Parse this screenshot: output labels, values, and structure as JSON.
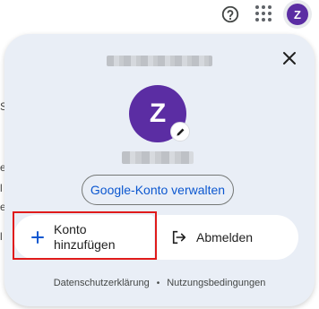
{
  "topbar": {
    "help_icon": "help-circle-icon",
    "apps_icon": "apps-grid-icon",
    "avatar_letter": "Z"
  },
  "page_left_edge": [
    "S",
    "e",
    "l",
    "e",
    "l"
  ],
  "account_panel": {
    "close_icon": "close-icon",
    "avatar_letter": "Z",
    "edit_icon": "pencil-icon",
    "manage_account_label": "Google-Konto verwalten",
    "add_account_label": "Konto hinzufügen",
    "add_icon": "plus-icon",
    "sign_out_label": "Abmelden",
    "sign_out_icon": "logout-icon",
    "footer": {
      "privacy": "Datenschutzerklärung",
      "separator": "•",
      "terms": "Nutzungsbedingungen"
    }
  },
  "colors": {
    "avatar": "#5b2da3",
    "panel_bg": "#e9eef6",
    "link_blue": "#0b57d0",
    "highlight_red": "#e01b1b"
  }
}
